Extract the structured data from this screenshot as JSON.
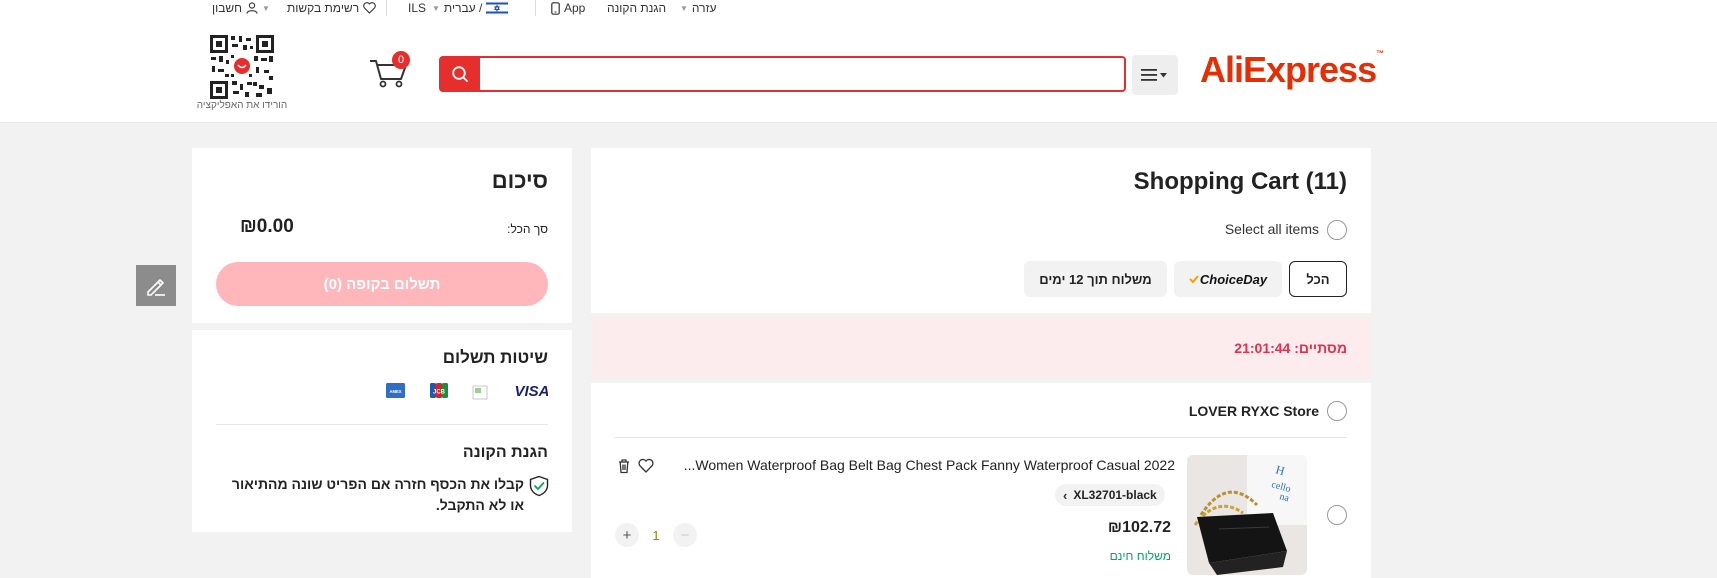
{
  "topbar": {
    "help": "עזרה",
    "buyer_protection": "הגנת הקונה",
    "app": "App",
    "lang": "/ עברית",
    "currency": "ILS",
    "wishlist": "רשימת בקשות",
    "account": "חשבון"
  },
  "header": {
    "logo": "AliExpress",
    "search_placeholder": "",
    "search_value": "",
    "cart_count": "0",
    "qr_label": "הורידו את האפליקציה"
  },
  "summary": {
    "title": "סיכום",
    "total_label": "סך הכל:",
    "total_value": "₪0.00",
    "checkout_label": "תשלום בקופה (0)"
  },
  "payment": {
    "title": "שיטות תשלום",
    "methods": [
      "VISA",
      "JCB",
      "AMEX"
    ],
    "protection_title": "הגנת הקונה",
    "protection_text": "קבלו את הכסף חזרה אם הפריט שונה מהתיאור או לא התקבל."
  },
  "cart": {
    "title": "Shopping Cart (11)",
    "select_all": "Select all items",
    "tabs": [
      {
        "label": "הכל",
        "active": true
      },
      {
        "label": "ChoiceDay",
        "active": false
      },
      {
        "label": "משלוח תוך 12 ימים",
        "active": false
      }
    ],
    "countdown": "מסתיים: 21:01:44"
  },
  "store": {
    "name": "LOVER RYXC Store",
    "item": {
      "title": "2022 Women Waterproof Bag Belt Bag Chest Pack Fanny Waterproof Casual...",
      "sku": "XL32701-black",
      "price": "₪102.72",
      "shipping": "משלוח חינם",
      "quantity": "1"
    }
  },
  "colors": {
    "brand": "#e62e04",
    "search_red": "#e62e2d",
    "checkout_disabled": "#ffb7bc",
    "countdown_bg": "#fdecee",
    "free_shipping": "#00a862"
  }
}
